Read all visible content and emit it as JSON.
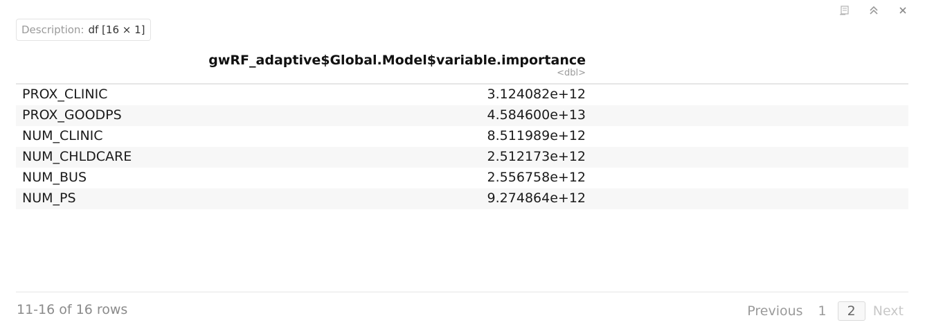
{
  "window_controls": {
    "icons": [
      "popout-icon",
      "collapse-icon",
      "close-icon"
    ]
  },
  "description": {
    "label": "Description:",
    "value": "df [16 × 1]"
  },
  "table": {
    "column_header": "gwRF_adaptive$Global.Model$variable.importance",
    "column_type": "<dbl>",
    "rows": [
      {
        "name": "PROX_CLINIC",
        "value": "3.124082e+12"
      },
      {
        "name": "PROX_GOODPS",
        "value": "4.584600e+13"
      },
      {
        "name": "NUM_CLINIC",
        "value": "8.511989e+12"
      },
      {
        "name": "NUM_CHLDCARE",
        "value": "2.512173e+12"
      },
      {
        "name": "NUM_BUS",
        "value": "2.556758e+12"
      },
      {
        "name": "NUM_PS",
        "value": "9.274864e+12"
      }
    ]
  },
  "footer": {
    "row_info": "11-16 of 16 rows",
    "previous_label": "Previous",
    "page_1": "1",
    "page_2": "2",
    "next_label": "Next"
  }
}
